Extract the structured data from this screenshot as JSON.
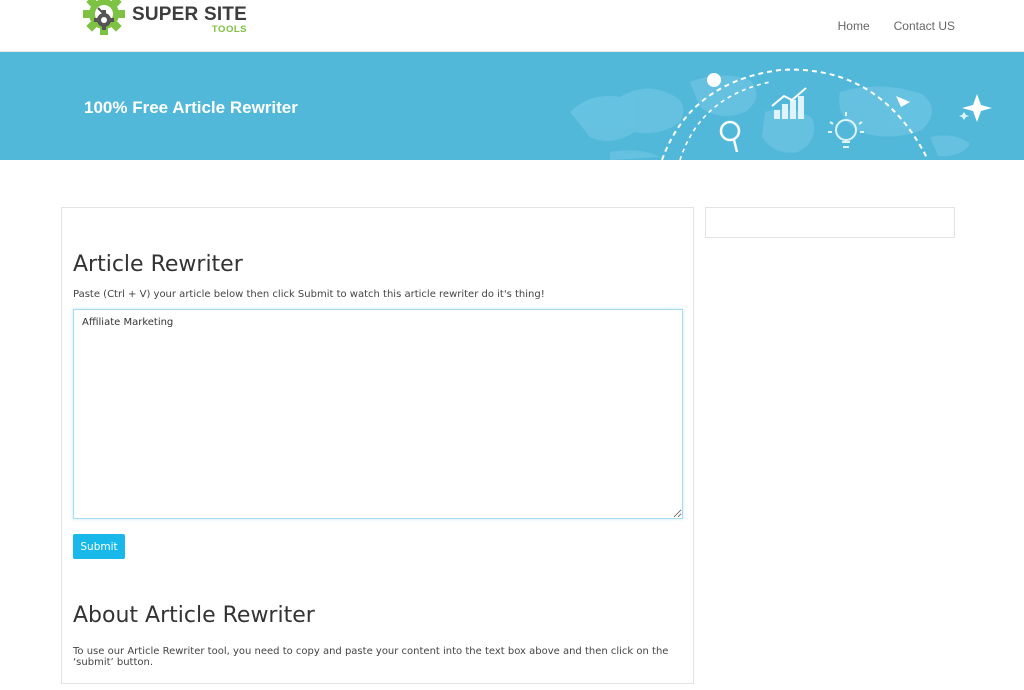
{
  "header": {
    "logo": {
      "main": "SUPER SITE",
      "sub": "TOOLS"
    },
    "nav": [
      {
        "label": "Home"
      },
      {
        "label": "Contact US"
      }
    ]
  },
  "banner": {
    "title": "100% Free Article Rewriter"
  },
  "main": {
    "title": "Article Rewriter",
    "intro": "Paste (Ctrl + V) your article below then click Submit to watch this article rewriter do it's thing!",
    "editor_value": "Affiliate Marketing",
    "submit_label": "Submit",
    "about_title": "About Article Rewriter",
    "about_text": "To use our Article Rewriter tool, you need to copy and paste your content into the text box above and then click on the ‘submit’ button."
  },
  "colors": {
    "banner": "#52b8da",
    "accent_button": "#18b8ea",
    "logo_green": "#7dc242",
    "logo_dark": "#3d3d3d"
  },
  "icons": [
    "gear-logo-icon",
    "magnifier-icon",
    "bar-chart-icon",
    "lightbulb-icon",
    "paper-plane-icon",
    "sparkle-icon",
    "world-map-icon"
  ]
}
